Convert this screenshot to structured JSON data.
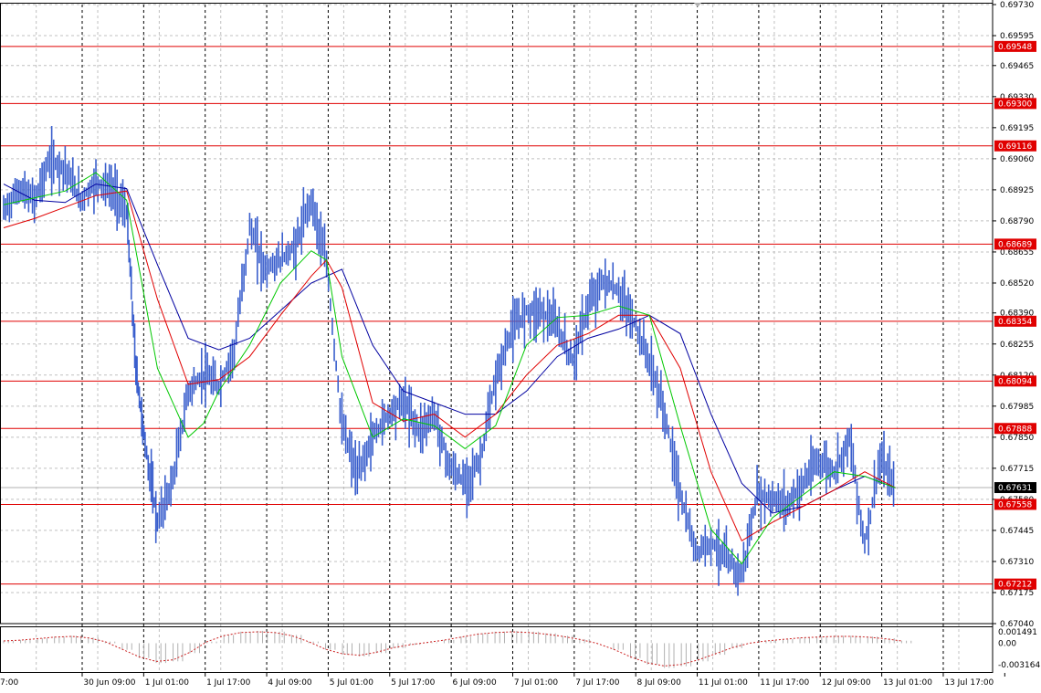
{
  "chart_data": {
    "type": "line",
    "colors": {
      "price": "#3a5fcd",
      "ma_fast": "#00c800",
      "ma_mid": "#e00000",
      "ma_slow": "#0000a0",
      "level": "#e00000",
      "grid": "#c0c0c0",
      "session": "#000000",
      "osc": "#b0b0b0",
      "osc_signal": "#cc2222"
    },
    "price_axis": {
      "ticks": [
        "0.69730",
        "0.69595",
        "0.69465",
        "0.69330",
        "0.69195",
        "0.69060",
        "0.68925",
        "0.68790",
        "0.68655",
        "0.68520",
        "0.68390",
        "0.68255",
        "0.68120",
        "0.67985",
        "0.67850",
        "0.67715",
        "0.67580",
        "0.67445",
        "0.67310",
        "0.67175",
        "0.67040"
      ],
      "min": 0.6704,
      "max": 0.6973
    },
    "levels": [
      {
        "label": "0.69548",
        "value": 0.69548
      },
      {
        "label": "0.69300",
        "value": 0.693
      },
      {
        "label": "0.69116",
        "value": 0.69116
      },
      {
        "label": "0.68689",
        "value": 0.68689
      },
      {
        "label": "0.68354",
        "value": 0.68354
      },
      {
        "label": "0.68094",
        "value": 0.68094
      },
      {
        "label": "0.67888",
        "value": 0.67888
      },
      {
        "label": "0.67558",
        "value": 0.67558
      },
      {
        "label": "0.67212",
        "value": 0.67212
      }
    ],
    "current_price": {
      "label": "0.67631",
      "value": 0.67631
    },
    "time_labels": [
      "7:00",
      "30 Jun 09:00",
      "1 Jul 01:00",
      "1 Jul 17:00",
      "4 Jul 09:00",
      "5 Jul 01:00",
      "5 Jul 17:00",
      "6 Jul 09:00",
      "7 Jul 01:00",
      "7 Jul 17:00",
      "8 Jul 09:00",
      "11 Jul 01:00",
      "11 Jul 17:00",
      "12 Jul 09:00",
      "13 Jul 01:00",
      "13 Jul 17:00"
    ],
    "osc_axis": {
      "ticks": [
        "0.001491",
        "0.00",
        "-0.003164"
      ],
      "min": -0.003164,
      "max": 0.001491
    },
    "price_series": [
      {
        "t": 0.0,
        "v": 0.6883
      },
      {
        "t": 0.25,
        "v": 0.6893
      },
      {
        "t": 0.5,
        "v": 0.6888
      },
      {
        "t": 0.75,
        "v": 0.6905
      },
      {
        "t": 1.0,
        "v": 0.6902
      },
      {
        "t": 1.25,
        "v": 0.6888
      },
      {
        "t": 1.5,
        "v": 0.6896
      },
      {
        "t": 1.75,
        "v": 0.6893
      },
      {
        "t": 2.0,
        "v": 0.6883
      },
      {
        "t": 2.15,
        "v": 0.6815
      },
      {
        "t": 2.3,
        "v": 0.6782
      },
      {
        "t": 2.5,
        "v": 0.6748
      },
      {
        "t": 2.75,
        "v": 0.6766
      },
      {
        "t": 3.0,
        "v": 0.6805
      },
      {
        "t": 3.25,
        "v": 0.6812
      },
      {
        "t": 3.5,
        "v": 0.6807
      },
      {
        "t": 3.75,
        "v": 0.6823
      },
      {
        "t": 4.0,
        "v": 0.6876
      },
      {
        "t": 4.25,
        "v": 0.6858
      },
      {
        "t": 4.5,
        "v": 0.6862
      },
      {
        "t": 4.75,
        "v": 0.6868
      },
      {
        "t": 5.0,
        "v": 0.6889
      },
      {
        "t": 5.25,
        "v": 0.686
      },
      {
        "t": 5.5,
        "v": 0.679
      },
      {
        "t": 5.75,
        "v": 0.6768
      },
      {
        "t": 6.0,
        "v": 0.6785
      },
      {
        "t": 6.25,
        "v": 0.6795
      },
      {
        "t": 6.5,
        "v": 0.6801
      },
      {
        "t": 6.75,
        "v": 0.6788
      },
      {
        "t": 7.0,
        "v": 0.6795
      },
      {
        "t": 7.25,
        "v": 0.6772
      },
      {
        "t": 7.5,
        "v": 0.6765
      },
      {
        "t": 7.75,
        "v": 0.6775
      },
      {
        "t": 8.0,
        "v": 0.681
      },
      {
        "t": 8.25,
        "v": 0.6831
      },
      {
        "t": 8.5,
        "v": 0.684
      },
      {
        "t": 8.75,
        "v": 0.684
      },
      {
        "t": 9.0,
        "v": 0.6833
      },
      {
        "t": 9.25,
        "v": 0.6818
      },
      {
        "t": 9.5,
        "v": 0.6842
      },
      {
        "t": 9.75,
        "v": 0.6853
      },
      {
        "t": 10.0,
        "v": 0.6848
      },
      {
        "t": 10.25,
        "v": 0.6835
      },
      {
        "t": 10.5,
        "v": 0.6818
      },
      {
        "t": 10.75,
        "v": 0.6795
      },
      {
        "t": 11.0,
        "v": 0.676
      },
      {
        "t": 11.25,
        "v": 0.6735
      },
      {
        "t": 11.5,
        "v": 0.674
      },
      {
        "t": 11.75,
        "v": 0.6732
      },
      {
        "t": 12.0,
        "v": 0.6725
      },
      {
        "t": 12.25,
        "v": 0.676
      },
      {
        "t": 12.5,
        "v": 0.6758
      },
      {
        "t": 12.75,
        "v": 0.6756
      },
      {
        "t": 13.0,
        "v": 0.6765
      },
      {
        "t": 13.25,
        "v": 0.6775
      },
      {
        "t": 13.5,
        "v": 0.677
      },
      {
        "t": 13.75,
        "v": 0.6785
      },
      {
        "t": 14.0,
        "v": 0.6738
      },
      {
        "t": 14.25,
        "v": 0.6775
      },
      {
        "t": 14.5,
        "v": 0.6763
      }
    ],
    "ma_fast": [
      {
        "t": 0.0,
        "v": 0.6886
      },
      {
        "t": 0.5,
        "v": 0.6889
      },
      {
        "t": 1.0,
        "v": 0.6892
      },
      {
        "t": 1.5,
        "v": 0.69
      },
      {
        "t": 2.0,
        "v": 0.6888
      },
      {
        "t": 2.5,
        "v": 0.6815
      },
      {
        "t": 3.0,
        "v": 0.6785
      },
      {
        "t": 3.25,
        "v": 0.6791
      },
      {
        "t": 3.5,
        "v": 0.6805
      },
      {
        "t": 4.0,
        "v": 0.6825
      },
      {
        "t": 4.5,
        "v": 0.6852
      },
      {
        "t": 5.0,
        "v": 0.6866
      },
      {
        "t": 5.25,
        "v": 0.6862
      },
      {
        "t": 5.5,
        "v": 0.682
      },
      {
        "t": 6.0,
        "v": 0.6785
      },
      {
        "t": 6.5,
        "v": 0.6793
      },
      {
        "t": 7.0,
        "v": 0.679
      },
      {
        "t": 7.5,
        "v": 0.678
      },
      {
        "t": 8.0,
        "v": 0.679
      },
      {
        "t": 8.5,
        "v": 0.6825
      },
      {
        "t": 9.0,
        "v": 0.6837
      },
      {
        "t": 9.5,
        "v": 0.6838
      },
      {
        "t": 10.0,
        "v": 0.6842
      },
      {
        "t": 10.5,
        "v": 0.6838
      },
      {
        "t": 11.0,
        "v": 0.679
      },
      {
        "t": 11.5,
        "v": 0.6745
      },
      {
        "t": 12.0,
        "v": 0.673
      },
      {
        "t": 12.5,
        "v": 0.675
      },
      {
        "t": 13.0,
        "v": 0.676
      },
      {
        "t": 13.5,
        "v": 0.677
      },
      {
        "t": 14.0,
        "v": 0.6768
      },
      {
        "t": 14.5,
        "v": 0.6763
      }
    ],
    "ma_mid": [
      {
        "t": 0.0,
        "v": 0.6876
      },
      {
        "t": 0.5,
        "v": 0.688
      },
      {
        "t": 1.0,
        "v": 0.6885
      },
      {
        "t": 1.5,
        "v": 0.689
      },
      {
        "t": 2.0,
        "v": 0.6892
      },
      {
        "t": 2.5,
        "v": 0.6845
      },
      {
        "t": 3.0,
        "v": 0.6808
      },
      {
        "t": 3.5,
        "v": 0.681
      },
      {
        "t": 4.0,
        "v": 0.682
      },
      {
        "t": 4.5,
        "v": 0.6838
      },
      {
        "t": 5.0,
        "v": 0.6855
      },
      {
        "t": 5.25,
        "v": 0.6862
      },
      {
        "t": 5.5,
        "v": 0.685
      },
      {
        "t": 6.0,
        "v": 0.68
      },
      {
        "t": 6.5,
        "v": 0.6792
      },
      {
        "t": 7.0,
        "v": 0.6795
      },
      {
        "t": 7.5,
        "v": 0.6785
      },
      {
        "t": 8.0,
        "v": 0.6795
      },
      {
        "t": 8.5,
        "v": 0.6812
      },
      {
        "t": 9.0,
        "v": 0.6825
      },
      {
        "t": 9.5,
        "v": 0.683
      },
      {
        "t": 10.0,
        "v": 0.6838
      },
      {
        "t": 10.5,
        "v": 0.6838
      },
      {
        "t": 11.0,
        "v": 0.6815
      },
      {
        "t": 11.5,
        "v": 0.677
      },
      {
        "t": 12.0,
        "v": 0.674
      },
      {
        "t": 12.5,
        "v": 0.6748
      },
      {
        "t": 13.0,
        "v": 0.6755
      },
      {
        "t": 13.5,
        "v": 0.6762
      },
      {
        "t": 14.0,
        "v": 0.677
      },
      {
        "t": 14.5,
        "v": 0.6763
      }
    ],
    "ma_slow": [
      {
        "t": 0.0,
        "v": 0.6895
      },
      {
        "t": 0.5,
        "v": 0.6888
      },
      {
        "t": 1.0,
        "v": 0.6887
      },
      {
        "t": 1.5,
        "v": 0.6895
      },
      {
        "t": 2.0,
        "v": 0.6893
      },
      {
        "t": 2.5,
        "v": 0.686
      },
      {
        "t": 3.0,
        "v": 0.6828
      },
      {
        "t": 3.5,
        "v": 0.6823
      },
      {
        "t": 4.0,
        "v": 0.6828
      },
      {
        "t": 4.5,
        "v": 0.684
      },
      {
        "t": 5.0,
        "v": 0.6852
      },
      {
        "t": 5.5,
        "v": 0.6858
      },
      {
        "t": 6.0,
        "v": 0.6825
      },
      {
        "t": 6.5,
        "v": 0.6805
      },
      {
        "t": 7.0,
        "v": 0.68
      },
      {
        "t": 7.5,
        "v": 0.6795
      },
      {
        "t": 8.0,
        "v": 0.6795
      },
      {
        "t": 8.5,
        "v": 0.6805
      },
      {
        "t": 9.0,
        "v": 0.682
      },
      {
        "t": 9.5,
        "v": 0.6828
      },
      {
        "t": 10.0,
        "v": 0.6832
      },
      {
        "t": 10.5,
        "v": 0.6838
      },
      {
        "t": 11.0,
        "v": 0.683
      },
      {
        "t": 11.5,
        "v": 0.6795
      },
      {
        "t": 12.0,
        "v": 0.6765
      },
      {
        "t": 12.5,
        "v": 0.6752
      },
      {
        "t": 13.0,
        "v": 0.6755
      },
      {
        "t": 13.5,
        "v": 0.6762
      },
      {
        "t": 14.0,
        "v": 0.6768
      },
      {
        "t": 14.5,
        "v": 0.6763
      }
    ],
    "oscillator": [
      0.0003,
      0.0004,
      0.0006,
      0.0008,
      0.0009,
      0.0007,
      0.0002,
      -0.0008,
      -0.0018,
      -0.0024,
      -0.0022,
      -0.0012,
      0.0002,
      0.001,
      0.0014,
      0.0015,
      0.0014,
      0.001,
      0.0002,
      -0.0008,
      -0.0014,
      -0.0016,
      -0.0012,
      -0.0006,
      -0.0002,
      0.0001,
      0.0004,
      0.0008,
      0.0012,
      0.0014,
      0.0015,
      0.0014,
      0.0012,
      0.0009,
      0.0005,
      0.0,
      -0.0008,
      -0.0018,
      -0.0026,
      -0.003,
      -0.0028,
      -0.0022,
      -0.0014,
      -0.0006,
      0.0,
      0.0003,
      0.0005,
      0.0007,
      0.0008,
      0.0009,
      0.0009,
      0.0008,
      0.0006,
      0.0003
    ]
  }
}
